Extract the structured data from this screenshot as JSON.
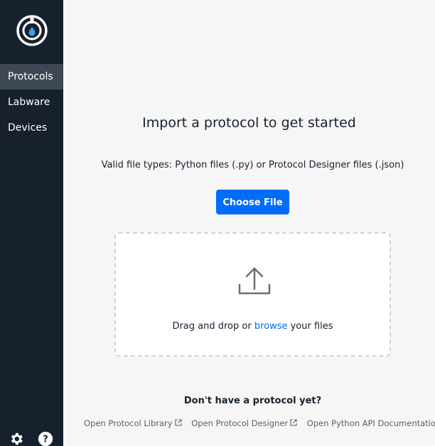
{
  "sidebar": {
    "nav": [
      {
        "label": "Protocols",
        "active": true
      },
      {
        "label": "Labware",
        "active": false
      },
      {
        "label": "Devices",
        "active": false
      }
    ],
    "icons": [
      "opentrons-logo-icon",
      "gear-icon",
      "help-icon"
    ]
  },
  "main": {
    "title": "Import a protocol to get started",
    "filetypes_text": "Valid file types: Python files (.py) or Protocol Designer files (.json)",
    "choose_file_label": "Choose File",
    "dropzone": {
      "text_before": "Drag and drop or ",
      "browse_label": "browse",
      "text_after": " your files",
      "icon": "upload-icon"
    },
    "no_protocol_text": "Don't have a protocol yet?",
    "links": [
      {
        "label": "Open Protocol Library",
        "icon": "external-link-icon"
      },
      {
        "label": "Open Protocol Designer",
        "icon": "external-link-icon"
      },
      {
        "label": "Open Python API Documentation",
        "icon": "external-link-icon"
      }
    ]
  },
  "colors": {
    "sidebar_bg": "#16212d",
    "sidebar_active": "#3e4855",
    "accent_blue": "#006cfa",
    "main_bg": "#f6f6f6"
  }
}
